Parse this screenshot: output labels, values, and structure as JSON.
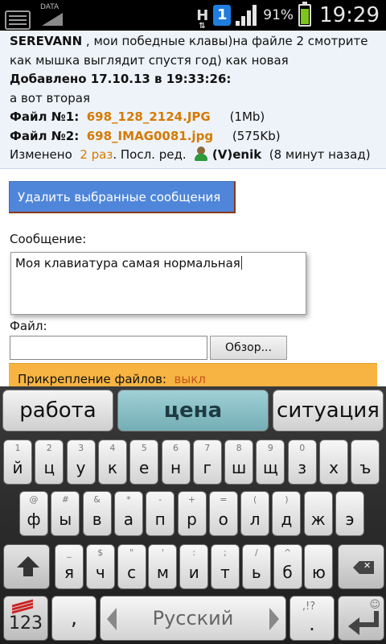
{
  "status_bar": {
    "data_label": "DATA",
    "network_letter": "H",
    "notification_badge": "1",
    "battery_percent": "91%",
    "time": "19:29",
    "icons": [
      "keyboard-icon",
      "data-icon",
      "network-h-icon",
      "notification-1-icon",
      "signal-icon",
      "battery-icon"
    ]
  },
  "post": {
    "author": "SEREVANN",
    "text_line1": " , мои  победные  клавы)на  файле  2  смотрите",
    "text_line2": "как  мышка  выглядит   спустя  год)  как новая",
    "added_label": "Добавлено   17.10.13   в 19:33:26:",
    "text_line3": "а вот  вторая",
    "file1_label": "Файл  №1:",
    "file1_name": "698_128_2124.JPG",
    "file1_size": "(1Mb)",
    "file2_label": "Файл  №2:",
    "file2_name": "698_IMAG0081.jpg",
    "file2_size": "(575Kb)",
    "edited_prefix": "Изменено",
    "edited_count": "2 раз",
    "edited_mid": ". Посл. ред.",
    "editor_name": "(V)enik",
    "edited_ago": "(8 минут  назад)"
  },
  "form": {
    "delete_button": "Удалить выбранные сообщения",
    "message_label": "Сообщение:",
    "message_value": "Моя клавиатура самая нормальная",
    "file_label": "Файл:",
    "file_value": "",
    "browse_button": "Обзор...",
    "attach_label": "Прикрепление   файлов:",
    "attach_value": "выкл"
  },
  "keyboard": {
    "suggestions": [
      "работа",
      "цена",
      "ситуация"
    ],
    "row1": [
      {
        "pri": "й",
        "sec": "1"
      },
      {
        "pri": "ц",
        "sec": "2"
      },
      {
        "pri": "у",
        "sec": "3"
      },
      {
        "pri": "к",
        "sec": "4"
      },
      {
        "pri": "е",
        "sec": "5"
      },
      {
        "pri": "н",
        "sec": "6"
      },
      {
        "pri": "г",
        "sec": "7"
      },
      {
        "pri": "ш",
        "sec": "8"
      },
      {
        "pri": "щ",
        "sec": "9"
      },
      {
        "pri": "з",
        "sec": "0"
      },
      {
        "pri": "х",
        "sec": ""
      },
      {
        "pri": "ъ",
        "sec": ""
      }
    ],
    "row2": [
      {
        "pri": "ф",
        "sec": "@"
      },
      {
        "pri": "ы",
        "sec": "#"
      },
      {
        "pri": "в",
        "sec": "&"
      },
      {
        "pri": "а",
        "sec": "*"
      },
      {
        "pri": "п",
        "sec": "-"
      },
      {
        "pri": "р",
        "sec": "+"
      },
      {
        "pri": "о",
        "sec": "="
      },
      {
        "pri": "л",
        "sec": "("
      },
      {
        "pri": "д",
        "sec": ")"
      },
      {
        "pri": "ж",
        "sec": ""
      },
      {
        "pri": "э",
        "sec": ""
      }
    ],
    "row3": [
      {
        "pri": "я",
        "sec": "_"
      },
      {
        "pri": "ч",
        "sec": "$"
      },
      {
        "pri": "с",
        "sec": "\""
      },
      {
        "pri": "м",
        "sec": "'"
      },
      {
        "pri": "и",
        "sec": ":"
      },
      {
        "pri": "т",
        "sec": ";"
      },
      {
        "pri": "ь",
        "sec": "/"
      },
      {
        "pri": "б",
        "sec": "^"
      },
      {
        "pri": "ю",
        "sec": ""
      }
    ],
    "key_123": "123",
    "key_comma": ",",
    "space_label": "Русский",
    "key_dot": ".",
    "key_dot_sec": ",!?",
    "enter_smiley": "☺"
  }
}
